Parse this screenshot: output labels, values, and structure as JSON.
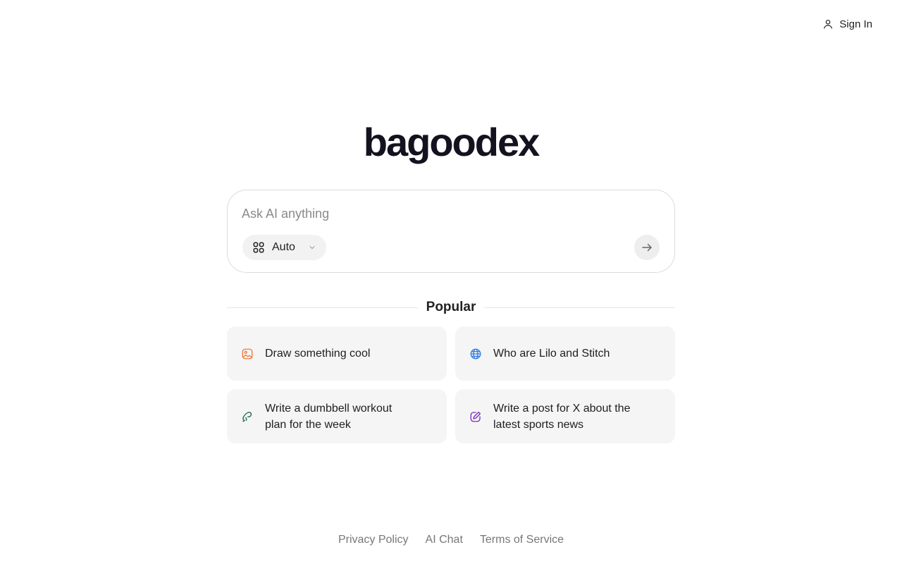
{
  "header": {
    "signin_label": "Sign In",
    "signin_icon": "user-icon"
  },
  "logo": {
    "text": "bagoodex"
  },
  "search": {
    "placeholder": "Ask AI anything",
    "value": "",
    "mode": {
      "selected": "Auto",
      "icon": "grid-icon"
    },
    "send_icon": "arrow-right-icon"
  },
  "popular": {
    "heading": "Popular",
    "items": [
      {
        "label": "Draw something cool",
        "icon": "image-icon",
        "color": "#f07a3a"
      },
      {
        "label": "Who are Lilo and Stitch",
        "icon": "globe-icon",
        "color": "#2f7de1"
      },
      {
        "label": "Write a dumbbell workout plan for the week",
        "icon": "dumbbell-icon",
        "color": "#1f6b4a"
      },
      {
        "label": "Write a post for X about the latest sports news",
        "icon": "edit-icon",
        "color": "#7a2fb6"
      }
    ]
  },
  "footer": {
    "links": [
      "Privacy Policy",
      "AI Chat",
      "Terms of Service"
    ]
  }
}
